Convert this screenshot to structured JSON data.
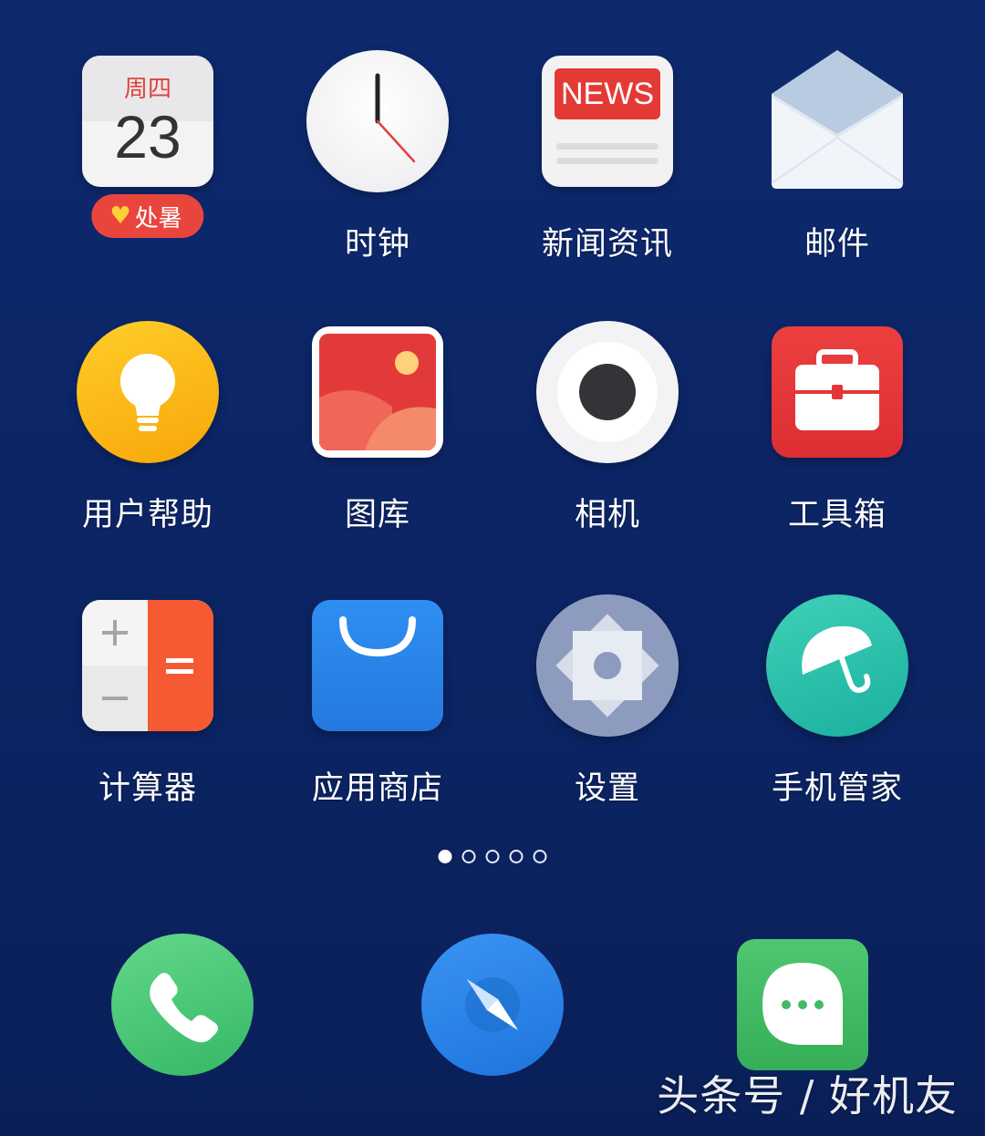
{
  "calendar": {
    "weekday": "周四",
    "day": "23",
    "badge": "处暑"
  },
  "news_banner": "NEWS",
  "apps": [
    {
      "id": "calendar",
      "label": ""
    },
    {
      "id": "clock",
      "label": "时钟"
    },
    {
      "id": "news",
      "label": "新闻资讯"
    },
    {
      "id": "mail",
      "label": "邮件"
    },
    {
      "id": "help",
      "label": "用户帮助"
    },
    {
      "id": "gallery",
      "label": "图库"
    },
    {
      "id": "camera",
      "label": "相机"
    },
    {
      "id": "toolbox",
      "label": "工具箱"
    },
    {
      "id": "calculator",
      "label": "计算器"
    },
    {
      "id": "appstore",
      "label": "应用商店"
    },
    {
      "id": "settings",
      "label": "设置"
    },
    {
      "id": "phone_manager",
      "label": "手机管家"
    }
  ],
  "page_indicator": {
    "count": 5,
    "active": 1
  },
  "dock": [
    {
      "id": "phone",
      "icon": "phone-icon"
    },
    {
      "id": "browser",
      "icon": "compass-icon"
    },
    {
      "id": "messages",
      "icon": "chat-bubble-icon"
    }
  ],
  "watermark": "头条号 / 好机友",
  "colors": {
    "background": "#0c2566",
    "badge": "#e8453c",
    "news_red": "#e43a36",
    "toolbox_red": "#e23636",
    "appstore_blue": "#2a84e8",
    "manager_teal": "#2cc0aa",
    "phone_green": "#4cc878",
    "browser_blue": "#2a84e8",
    "messages_green": "#43bb65"
  }
}
